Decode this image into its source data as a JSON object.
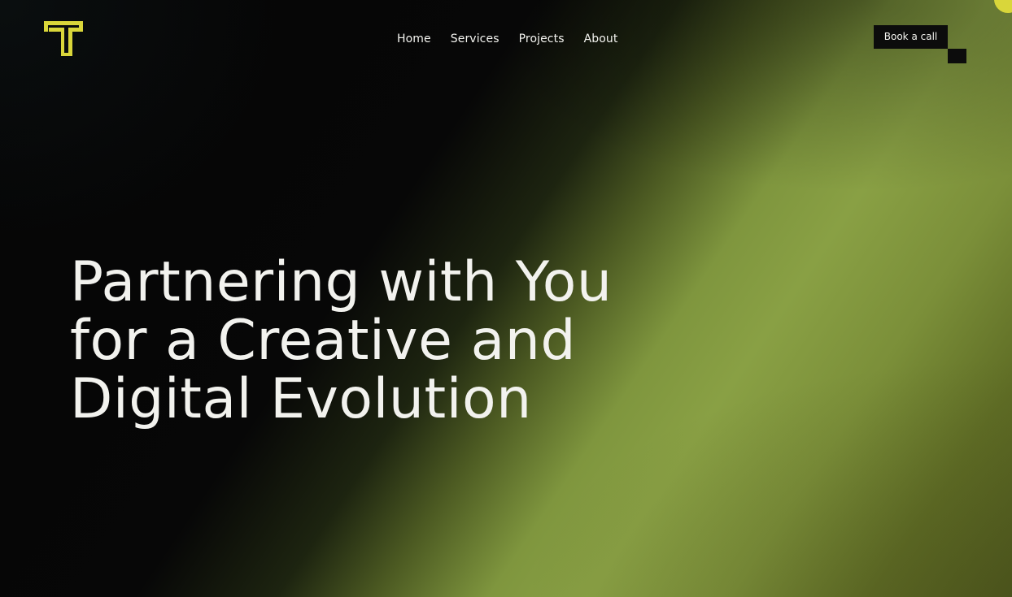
{
  "brand": {
    "logo_icon": "t-letter-logo-icon",
    "accent_color": "#d9d63a"
  },
  "nav": {
    "items": [
      {
        "label": "Home"
      },
      {
        "label": "Services"
      },
      {
        "label": "Projects"
      },
      {
        "label": "About"
      }
    ]
  },
  "header": {
    "cta_label": "Book a call"
  },
  "hero": {
    "lines": [
      "Partnering with You",
      "for a Creative and",
      "Digital Evolution"
    ]
  },
  "theme": {
    "background_dark": "#060606",
    "gradient_green": "#89a044",
    "text_color": "#f2f2ee"
  }
}
